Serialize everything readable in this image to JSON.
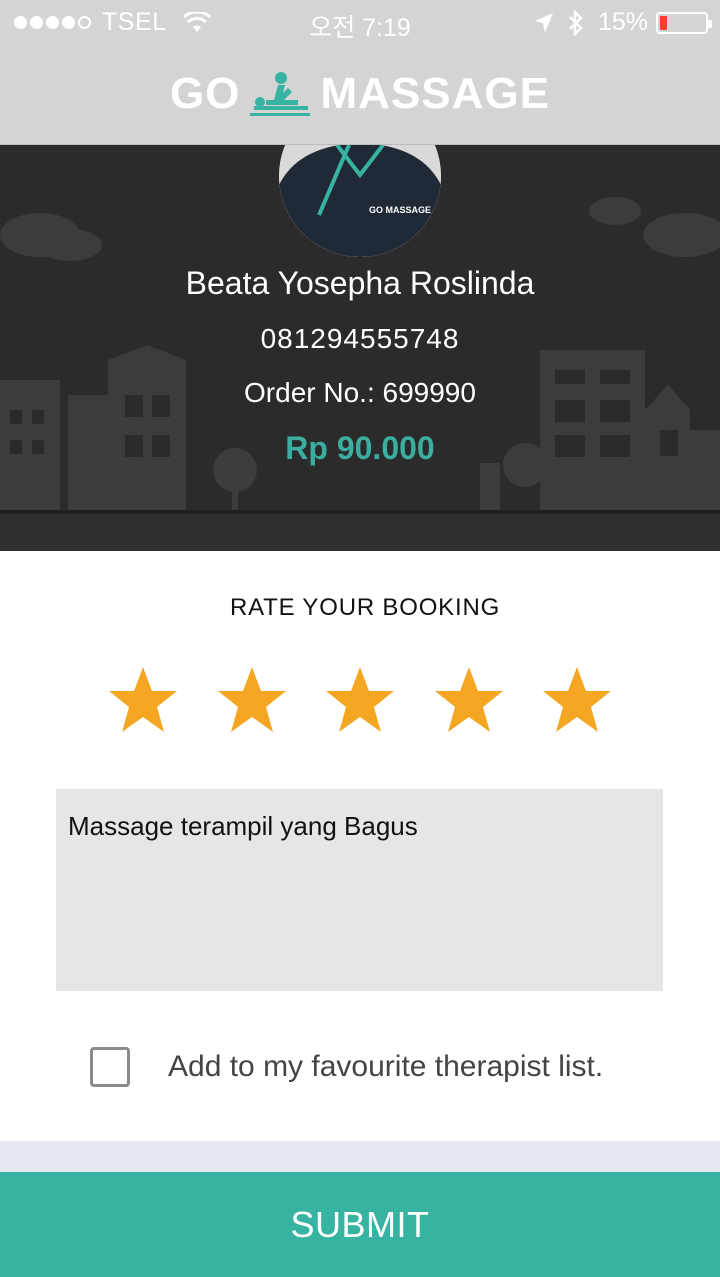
{
  "status_bar": {
    "carrier": "TSEL",
    "time": "오전 7:19",
    "battery": "15%",
    "battery_level": 0.15,
    "icons": [
      "signal-dots-icon",
      "wifi-icon",
      "location-arrow-icon",
      "bluetooth-icon",
      "battery-icon"
    ]
  },
  "header": {
    "logo_left": "GO",
    "logo_right": "MASSAGE",
    "logo_icon": "massage-therapist-icon"
  },
  "therapist": {
    "name": "Beata Yosepha Roslinda",
    "phone": "081294555748",
    "order": "Order No.: 699990",
    "price": "Rp 90.000",
    "avatar_shirt_text": "GO MASSAGE"
  },
  "rating": {
    "title": "RATE YOUR BOOKING",
    "value": 5,
    "max": 5
  },
  "review": {
    "value": "Massage terampil yang Bagus"
  },
  "favourite": {
    "label": "Add to my favourite therapist list.",
    "checked": false
  },
  "submit": {
    "label": "SUBMIT"
  },
  "colors": {
    "accent": "#37b3a2",
    "price": "#3aaea0",
    "star": "#f5a623",
    "hero_bg": "#2b2b2b",
    "header_bg": "#d4d4d4"
  }
}
